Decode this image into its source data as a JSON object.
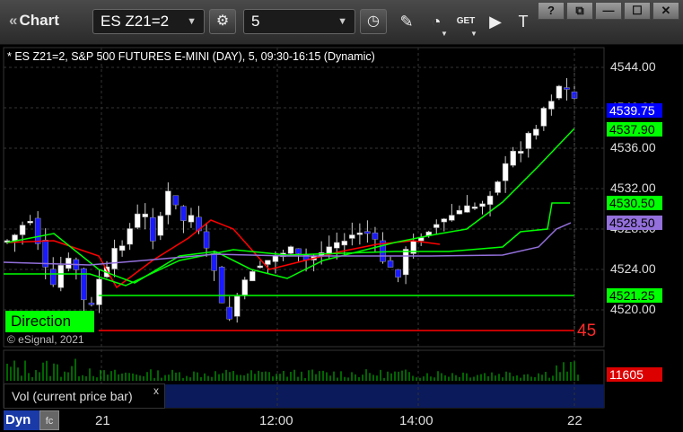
{
  "app": {
    "title": "Chart"
  },
  "toolbar": {
    "symbol": "ES Z21=2",
    "interval": "5",
    "get_label": "GET"
  },
  "window_controls": {
    "help": "?",
    "restore_small": "⧉",
    "minimize": "—",
    "maximize": "☐",
    "close": "✕"
  },
  "chart_info": {
    "text": "* ES Z21=2, S&P 500 FUTURES E-MINI (DAY), 5, 09:30-16:15 (Dynamic)"
  },
  "overlay": {
    "direction_label": "Direction",
    "copyright": "© eSignal, 2021",
    "count": "45"
  },
  "price_axis": {
    "ticks": [
      "4544.00",
      "4540.00",
      "4536.00",
      "4532.00",
      "4528.00",
      "4524.00",
      "4520.00"
    ],
    "badges": [
      {
        "value": "4539.75",
        "color": "#0000ff",
        "text_color": "#ffffff"
      },
      {
        "value": "4537.90",
        "color": "#00ff00",
        "text_color": "#000000"
      },
      {
        "value": "4530.50",
        "color": "#00ff00",
        "text_color": "#000000"
      },
      {
        "value": "4528.50",
        "color": "#9370db",
        "text_color": "#000000"
      },
      {
        "value": "4521.25",
        "color": "#00ff00",
        "text_color": "#000000"
      }
    ]
  },
  "volume": {
    "label": "Vol (current price bar)",
    "close": "x",
    "badge": "11605"
  },
  "time_axis": {
    "ticks": [
      "21",
      "12:00",
      "14:00",
      "22"
    ]
  },
  "bottom": {
    "dyn_label": "Dyn",
    "fc_label": "fc"
  },
  "colors": {
    "up_candle": "#ffffff",
    "down_candle": "#1a1aff",
    "ma_red": "#ff0000",
    "ma_green": "#00ff00",
    "ma_purple": "#9370db",
    "vol_bars": "#00cc00"
  }
}
